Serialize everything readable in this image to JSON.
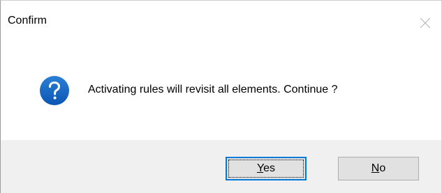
{
  "window": {
    "title": "Confirm"
  },
  "message": {
    "text": "Activating rules will revisit all elements. Continue ?",
    "icon": "question-icon",
    "icon_color": "#1565c0"
  },
  "buttons": {
    "yes": {
      "mnemonic": "Y",
      "rest": "es"
    },
    "no": {
      "mnemonic": "N",
      "rest": "o"
    }
  },
  "colors": {
    "footer_bg": "#f0f0f0",
    "button_bg": "#e1e1e1",
    "focus_border": "#0078d7"
  }
}
